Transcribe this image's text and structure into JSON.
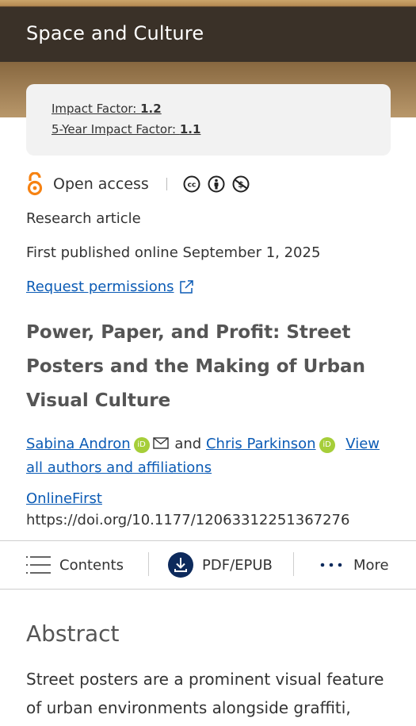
{
  "journal": {
    "title": "Space and Culture"
  },
  "impact": {
    "if_label": "Impact Factor: ",
    "if_value": "1.2",
    "fiveyr_label": "5-Year Impact Factor: ",
    "fiveyr_value": "1.1"
  },
  "access": {
    "label": "Open access",
    "license_icons": [
      "cc-icon",
      "by-icon",
      "nc-icon"
    ]
  },
  "article": {
    "type": "Research article",
    "published": "First published online September 1, 2025",
    "permissions_link": "Request permissions",
    "title": "Power, Paper, and Profit: Street Posters and the Making of Urban Visual Culture",
    "authors": {
      "author1": "Sabina Andron",
      "connector": "and",
      "author2": "Chris Parkinson",
      "view_all_part1": "View",
      "view_all_part2": "all authors and affiliations"
    },
    "status": "OnlineFirst",
    "doi": "https://doi.org/10.1177/12063312251367276"
  },
  "toolbar": {
    "contents": "Contents",
    "pdf": "PDF/EPUB",
    "more": "More"
  },
  "abstract": {
    "heading": "Abstract",
    "text": "Street posters are a prominent visual feature of urban environments alongside graffiti,"
  },
  "colors": {
    "link": "#0b5bb5",
    "oa_orange": "#f68212",
    "orcid_green": "#a6ce39",
    "pdf_navy": "#0d2a5c"
  }
}
